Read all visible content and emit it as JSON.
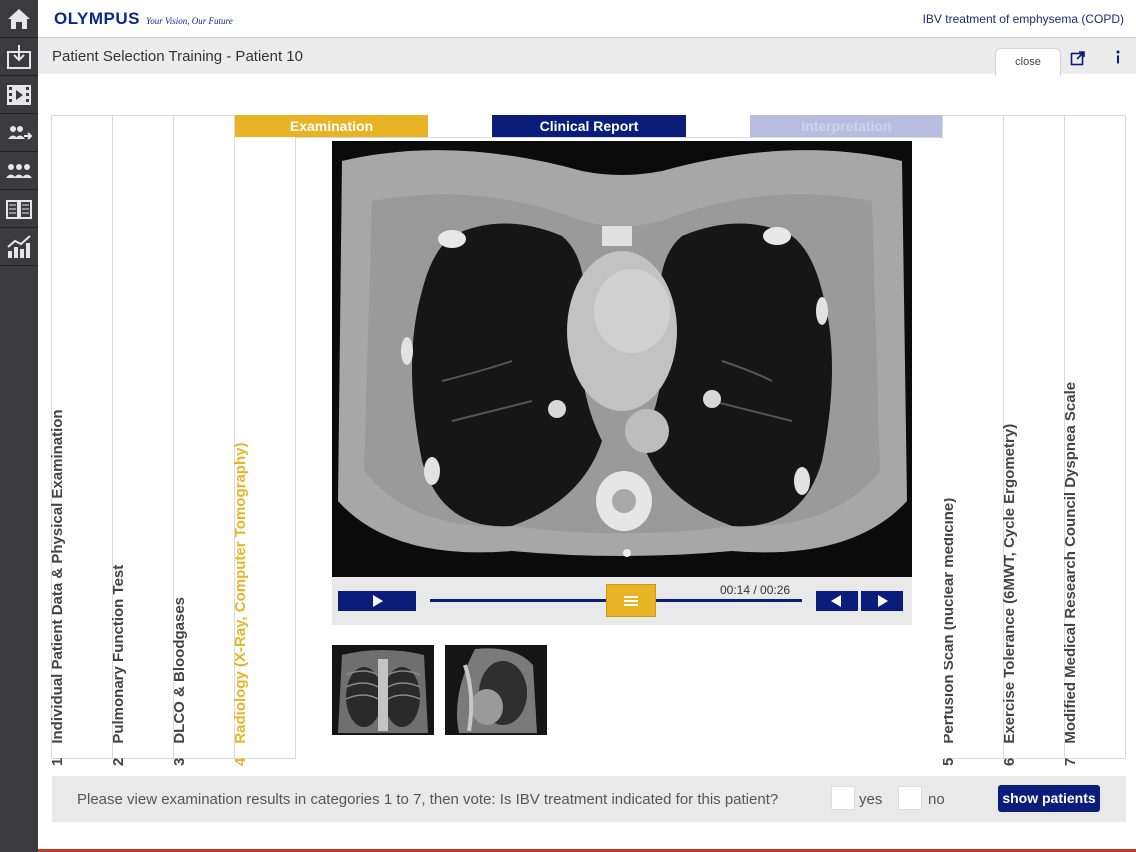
{
  "header": {
    "brand_name": "OLYMPUS",
    "brand_tagline": "Your Vision, Our Future",
    "app_title": "IBV treatment of emphysema (COPD)"
  },
  "subheader": {
    "page_title": "Patient Selection Training - Patient 10",
    "close_label": "close"
  },
  "sidebar": {
    "items": [
      {
        "icon": "home-icon"
      },
      {
        "icon": "download-icon"
      },
      {
        "icon": "video-icon"
      },
      {
        "icon": "patients-transfer-icon"
      },
      {
        "icon": "group-icon"
      },
      {
        "icon": "book-icon"
      },
      {
        "icon": "chart-icon"
      }
    ]
  },
  "phases": {
    "examination": "Examination",
    "clinical_report": "Clinical Report",
    "interpretation": "Interpretation"
  },
  "categories": [
    {
      "num": "1",
      "label": "Individual Patient Data & Physical Examination"
    },
    {
      "num": "2",
      "label": "Pulmonary Function Test"
    },
    {
      "num": "3",
      "label": "DLCO & Bloodgases"
    },
    {
      "num": "4",
      "label": "Radiology (X-Ray, Computer Tomography)"
    },
    {
      "num": "5",
      "label": "Perfusion Scan (nuclear medicine)"
    },
    {
      "num": "6",
      "label": "Exercise Tolerance (6MWT, Cycle Ergometry)"
    },
    {
      "num": "7",
      "label": "Modified Medical Research Council Dyspnea Scale"
    }
  ],
  "player": {
    "time_readout": "00:14 / 00:26",
    "progress_fraction": 0.54
  },
  "vote": {
    "question": "Please view examination results in categories 1 to 7, then vote: Is IBV treatment indicated for this patient?",
    "yes_label": "yes",
    "no_label": "no",
    "show_patients_label": "show patients"
  },
  "colors": {
    "accent_yellow": "#e8b425",
    "navy": "#0b1d7a",
    "sidebar": "#3b3b3d"
  }
}
